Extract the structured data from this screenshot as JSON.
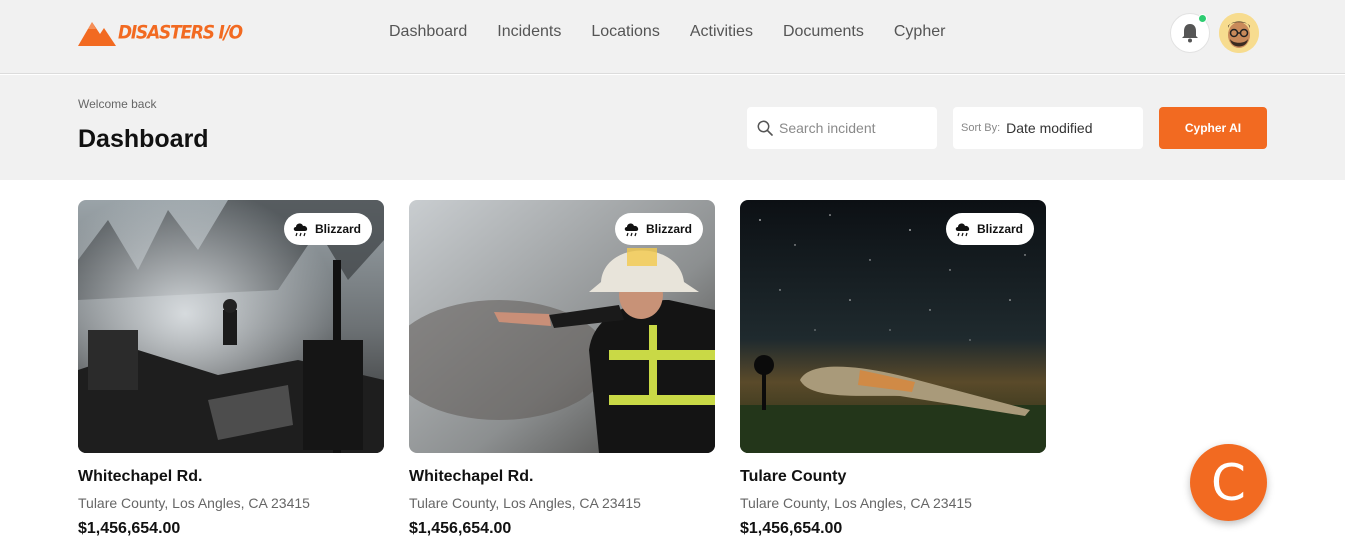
{
  "brand": {
    "name": "DISASTERS I/O",
    "accent": "#f26a21"
  },
  "nav": {
    "items": [
      "Dashboard",
      "Incidents",
      "Locations",
      "Activities",
      "Documents",
      "Cypher"
    ]
  },
  "header": {
    "notification_icon": "bell-icon",
    "notification_dot_color": "#2ecc71",
    "avatar_icon": "user-avatar"
  },
  "subheader": {
    "welcome": "Welcome back",
    "title": "Dashboard",
    "search_placeholder": "Search incident",
    "sort_label": "Sort By:",
    "sort_value": "Date modified",
    "cypher_button": "Cypher AI"
  },
  "cards": [
    {
      "badge": "Blizzard",
      "title": "Whitechapel Rd.",
      "address": "Tulare County, Los Angles, CA 23415",
      "price": "$1,456,654.00",
      "image": "firefighter-in-smoke-photo"
    },
    {
      "badge": "Blizzard",
      "title": "Whitechapel Rd.",
      "address": "Tulare County, Los Angles, CA 23415",
      "price": "$1,456,654.00",
      "image": "firefighter-pointing-photo"
    },
    {
      "badge": "Blizzard",
      "title": "Tulare County",
      "address": "Tulare County, Los Angles, CA 23415",
      "price": "$1,456,654.00",
      "image": "plane-wreck-night-photo"
    }
  ],
  "fab": {
    "label": "C"
  }
}
